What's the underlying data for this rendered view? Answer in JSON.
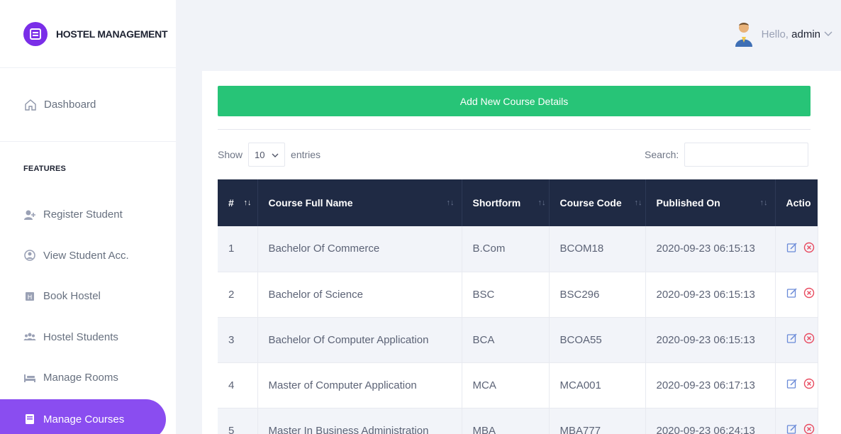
{
  "brand": {
    "name": "HOSTEL MANAGEMENT",
    "accent": "#7a2ee8"
  },
  "header": {
    "greeting": "Hello,",
    "user": "admin"
  },
  "sidebar": {
    "dashboard": "Dashboard",
    "section_title": "FEATURES",
    "items": [
      {
        "label": "Register Student",
        "icon": "user-plus-icon"
      },
      {
        "label": "View Student Acc.",
        "icon": "user-circle-icon"
      },
      {
        "label": "Book Hostel",
        "icon": "hostel-icon"
      },
      {
        "label": "Hostel Students",
        "icon": "users-icon"
      },
      {
        "label": "Manage Rooms",
        "icon": "bed-icon"
      },
      {
        "label": "Manage Courses",
        "icon": "book-icon",
        "active": true
      }
    ]
  },
  "main": {
    "add_button": "Add New Course Details",
    "show_label": "Show",
    "entries_value": "10",
    "entries_label": "entries",
    "search_label": "Search:",
    "search_value": "",
    "columns": [
      "#",
      "Course Full Name",
      "Shortform",
      "Course Code",
      "Published On",
      "Actio"
    ],
    "rows": [
      {
        "n": "1",
        "name": "Bachelor Of Commerce",
        "short": "B.Com",
        "code": "BCOM18",
        "date": "2020-09-23 06:15:13"
      },
      {
        "n": "2",
        "name": "Bachelor of Science",
        "short": "BSC",
        "code": "BSC296",
        "date": "2020-09-23 06:15:13"
      },
      {
        "n": "3",
        "name": "Bachelor Of Computer Application",
        "short": "BCA",
        "code": "BCOA55",
        "date": "2020-09-23 06:15:13"
      },
      {
        "n": "4",
        "name": "Master of Computer Application",
        "short": "MCA",
        "code": "MCA001",
        "date": "2020-09-23 06:17:13"
      },
      {
        "n": "5",
        "name": "Master In Business Administration",
        "short": "MBA",
        "code": "MBA777",
        "date": "2020-09-23 06:24:13"
      }
    ]
  },
  "colors": {
    "green": "#27c477",
    "header_dark": "#1f2a44",
    "active_nav": "#8a4df0"
  }
}
